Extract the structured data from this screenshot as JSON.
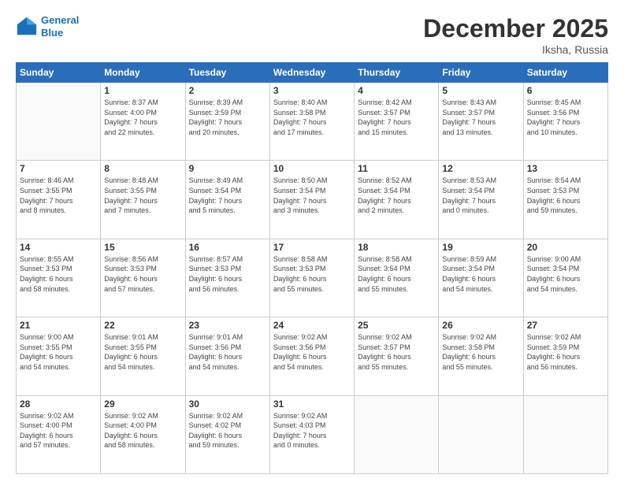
{
  "header": {
    "logo_line1": "General",
    "logo_line2": "Blue",
    "month": "December 2025",
    "location": "Iksha, Russia"
  },
  "weekdays": [
    "Sunday",
    "Monday",
    "Tuesday",
    "Wednesday",
    "Thursday",
    "Friday",
    "Saturday"
  ],
  "weeks": [
    [
      {
        "day": "",
        "info": ""
      },
      {
        "day": "1",
        "info": "Sunrise: 8:37 AM\nSunset: 4:00 PM\nDaylight: 7 hours\nand 22 minutes."
      },
      {
        "day": "2",
        "info": "Sunrise: 8:39 AM\nSunset: 3:59 PM\nDaylight: 7 hours\nand 20 minutes."
      },
      {
        "day": "3",
        "info": "Sunrise: 8:40 AM\nSunset: 3:58 PM\nDaylight: 7 hours\nand 17 minutes."
      },
      {
        "day": "4",
        "info": "Sunrise: 8:42 AM\nSunset: 3:57 PM\nDaylight: 7 hours\nand 15 minutes."
      },
      {
        "day": "5",
        "info": "Sunrise: 8:43 AM\nSunset: 3:57 PM\nDaylight: 7 hours\nand 13 minutes."
      },
      {
        "day": "6",
        "info": "Sunrise: 8:45 AM\nSunset: 3:56 PM\nDaylight: 7 hours\nand 10 minutes."
      }
    ],
    [
      {
        "day": "7",
        "info": "Sunrise: 8:46 AM\nSunset: 3:55 PM\nDaylight: 7 hours\nand 8 minutes."
      },
      {
        "day": "8",
        "info": "Sunrise: 8:48 AM\nSunset: 3:55 PM\nDaylight: 7 hours\nand 7 minutes."
      },
      {
        "day": "9",
        "info": "Sunrise: 8:49 AM\nSunset: 3:54 PM\nDaylight: 7 hours\nand 5 minutes."
      },
      {
        "day": "10",
        "info": "Sunrise: 8:50 AM\nSunset: 3:54 PM\nDaylight: 7 hours\nand 3 minutes."
      },
      {
        "day": "11",
        "info": "Sunrise: 8:52 AM\nSunset: 3:54 PM\nDaylight: 7 hours\nand 2 minutes."
      },
      {
        "day": "12",
        "info": "Sunrise: 8:53 AM\nSunset: 3:54 PM\nDaylight: 7 hours\nand 0 minutes."
      },
      {
        "day": "13",
        "info": "Sunrise: 8:54 AM\nSunset: 3:53 PM\nDaylight: 6 hours\nand 59 minutes."
      }
    ],
    [
      {
        "day": "14",
        "info": "Sunrise: 8:55 AM\nSunset: 3:53 PM\nDaylight: 6 hours\nand 58 minutes."
      },
      {
        "day": "15",
        "info": "Sunrise: 8:56 AM\nSunset: 3:53 PM\nDaylight: 6 hours\nand 57 minutes."
      },
      {
        "day": "16",
        "info": "Sunrise: 8:57 AM\nSunset: 3:53 PM\nDaylight: 6 hours\nand 56 minutes."
      },
      {
        "day": "17",
        "info": "Sunrise: 8:58 AM\nSunset: 3:53 PM\nDaylight: 6 hours\nand 55 minutes."
      },
      {
        "day": "18",
        "info": "Sunrise: 8:58 AM\nSunset: 3:54 PM\nDaylight: 6 hours\nand 55 minutes."
      },
      {
        "day": "19",
        "info": "Sunrise: 8:59 AM\nSunset: 3:54 PM\nDaylight: 6 hours\nand 54 minutes."
      },
      {
        "day": "20",
        "info": "Sunrise: 9:00 AM\nSunset: 3:54 PM\nDaylight: 6 hours\nand 54 minutes."
      }
    ],
    [
      {
        "day": "21",
        "info": "Sunrise: 9:00 AM\nSunset: 3:55 PM\nDaylight: 6 hours\nand 54 minutes."
      },
      {
        "day": "22",
        "info": "Sunrise: 9:01 AM\nSunset: 3:55 PM\nDaylight: 6 hours\nand 54 minutes."
      },
      {
        "day": "23",
        "info": "Sunrise: 9:01 AM\nSunset: 3:56 PM\nDaylight: 6 hours\nand 54 minutes."
      },
      {
        "day": "24",
        "info": "Sunrise: 9:02 AM\nSunset: 3:56 PM\nDaylight: 6 hours\nand 54 minutes."
      },
      {
        "day": "25",
        "info": "Sunrise: 9:02 AM\nSunset: 3:57 PM\nDaylight: 6 hours\nand 55 minutes."
      },
      {
        "day": "26",
        "info": "Sunrise: 9:02 AM\nSunset: 3:58 PM\nDaylight: 6 hours\nand 55 minutes."
      },
      {
        "day": "27",
        "info": "Sunrise: 9:02 AM\nSunset: 3:59 PM\nDaylight: 6 hours\nand 56 minutes."
      }
    ],
    [
      {
        "day": "28",
        "info": "Sunrise: 9:02 AM\nSunset: 4:00 PM\nDaylight: 6 hours\nand 57 minutes."
      },
      {
        "day": "29",
        "info": "Sunrise: 9:02 AM\nSunset: 4:00 PM\nDaylight: 6 hours\nand 58 minutes."
      },
      {
        "day": "30",
        "info": "Sunrise: 9:02 AM\nSunset: 4:02 PM\nDaylight: 6 hours\nand 59 minutes."
      },
      {
        "day": "31",
        "info": "Sunrise: 9:02 AM\nSunset: 4:03 PM\nDaylight: 7 hours\nand 0 minutes."
      },
      {
        "day": "",
        "info": ""
      },
      {
        "day": "",
        "info": ""
      },
      {
        "day": "",
        "info": ""
      }
    ]
  ]
}
